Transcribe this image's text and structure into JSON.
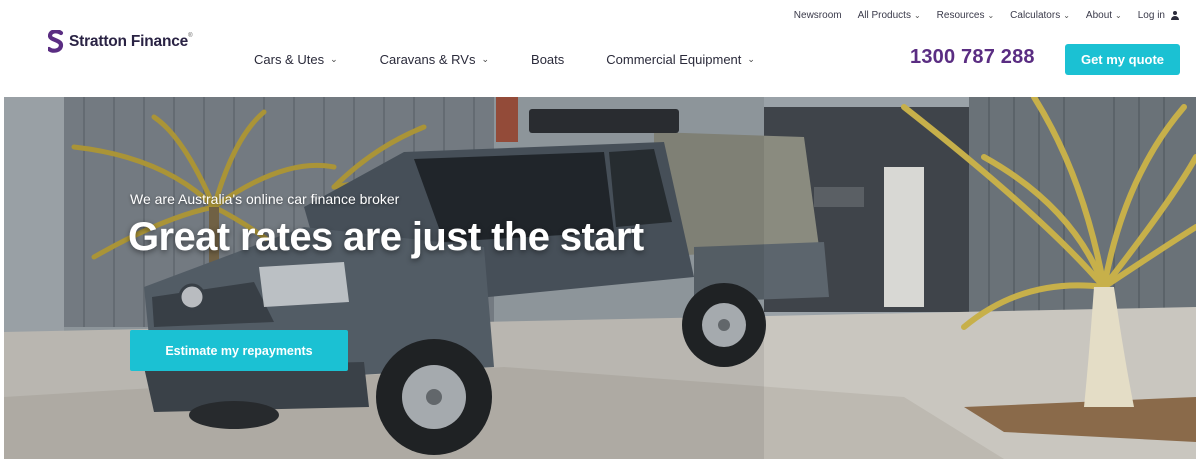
{
  "header": {
    "logo": {
      "name": "Stratton Finance",
      "trademark": "®"
    },
    "utility_nav": [
      {
        "label": "Newsroom",
        "has_dropdown": false
      },
      {
        "label": "All Products",
        "has_dropdown": true
      },
      {
        "label": "Resources",
        "has_dropdown": true
      },
      {
        "label": "Calculators",
        "has_dropdown": true
      },
      {
        "label": "About",
        "has_dropdown": true
      },
      {
        "label": "Log in",
        "icon": "user-icon"
      }
    ],
    "main_nav": [
      {
        "label": "Cars & Utes",
        "has_dropdown": true
      },
      {
        "label": "Caravans & RVs",
        "has_dropdown": true
      },
      {
        "label": "Boats",
        "has_dropdown": false
      },
      {
        "label": "Commercial Equipment",
        "has_dropdown": true
      }
    ],
    "phone": "1300 787 288",
    "cta_label": "Get my quote"
  },
  "hero": {
    "subtitle": "We are Australia's online car finance broker",
    "title": "Great rates are just the start",
    "cta_label": "Estimate my repayments",
    "image_icon": "ute-in-driveway-photo"
  },
  "colors": {
    "brand_purple": "#5a2d82",
    "accent_cyan": "#1bc1d3",
    "logo_dark": "#2a2344"
  }
}
